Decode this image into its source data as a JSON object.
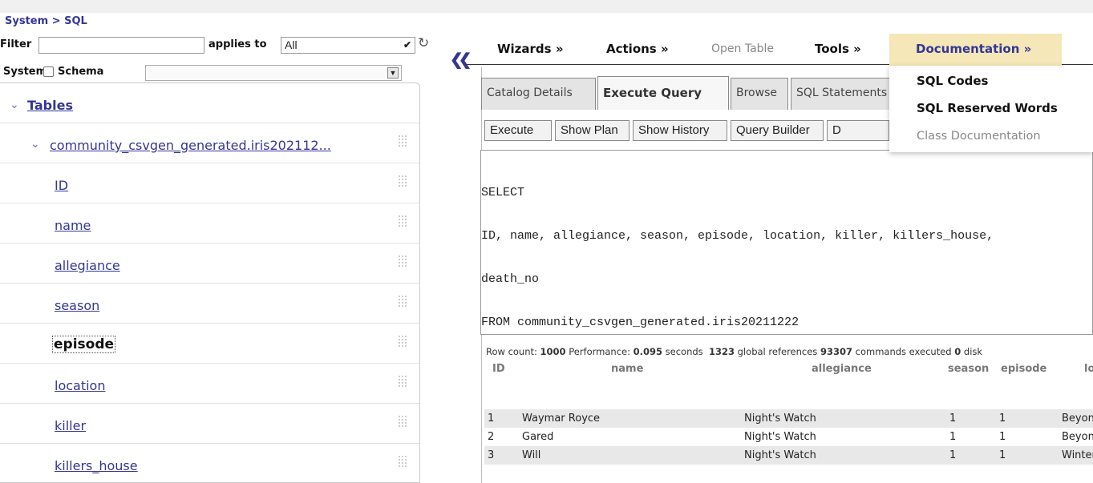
{
  "breadcrumb": "System > SQL",
  "filter": {
    "label": "Filter",
    "value": "",
    "applies_label": "applies to",
    "applies_value": "All"
  },
  "schema": {
    "system_label": "System",
    "schema_label": "Schema",
    "value": ""
  },
  "tree": {
    "root": "Tables",
    "table": "community_csvgen_generated.iris202112...",
    "columns": [
      "ID",
      "name",
      "allegiance",
      "season",
      "episode",
      "location",
      "killer",
      "killers_house"
    ],
    "selected": "episode"
  },
  "menu": {
    "wizards": "Wizards »",
    "actions": "Actions »",
    "open_table": "Open Table",
    "tools": "Tools »",
    "documentation": "Documentation »"
  },
  "doc_dropdown": [
    "SQL Codes",
    "SQL Reserved Words",
    "Class Documentation"
  ],
  "tabs": [
    "Catalog Details",
    "Execute Query",
    "Browse",
    "SQL Statements"
  ],
  "active_tab": "Execute Query",
  "buttons": [
    "Execute",
    "Show Plan",
    "Show History",
    "Query Builder",
    "D"
  ],
  "query_lines": [
    "SELECT",
    "ID, name, allegiance, season, episode, location, killer, killers_house,",
    "death_no",
    "FROM community_csvgen_generated.iris20211222"
  ],
  "stats": {
    "row_count_label": "Row count:",
    "row_count": "1000",
    "performance_label": "Performance:",
    "seconds": "0.095",
    "seconds_label": "seconds",
    "global_refs": "1323",
    "global_refs_label": "global references",
    "commands": "93307",
    "commands_label": "commands executed",
    "disk": "0",
    "disk_label": "disk"
  },
  "results": {
    "headers": [
      "ID",
      "name",
      "allegiance",
      "season",
      "episode",
      "location"
    ],
    "rows": [
      [
        "1",
        "Waymar Royce",
        "Night's Watch",
        "1",
        "1",
        "Beyond the Wall"
      ],
      [
        "2",
        "Gared",
        "Night's Watch",
        "1",
        "1",
        "Beyond the Wall"
      ],
      [
        "3",
        "Will",
        "Night's Watch",
        "1",
        "1",
        "Winterfell"
      ]
    ]
  },
  "colors": {
    "link": "#333695",
    "doc_highlight": "#f5e7b7",
    "row_stripe": "#e8e8e8"
  }
}
